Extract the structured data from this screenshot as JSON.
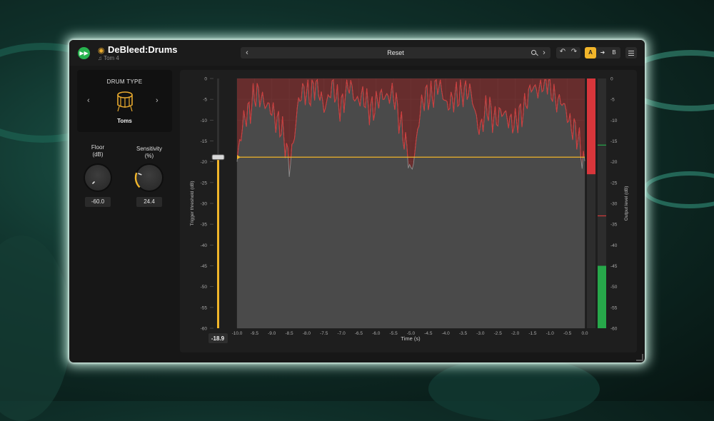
{
  "app": {
    "title": "DeBleed:Drums",
    "subtitle": "Tom 4"
  },
  "preset": {
    "name": "Reset"
  },
  "ab": {
    "a_label": "A",
    "b_label": "B"
  },
  "drum_type": {
    "title": "DRUM TYPE",
    "name": "Toms"
  },
  "floor": {
    "label_line1": "Floor",
    "label_line2": "(dB)",
    "value": "-60.0"
  },
  "sensitivity": {
    "label_line1": "Sensitivity",
    "label_line2": "(%)",
    "value": "24.4",
    "level_percent": 24.4
  },
  "threshold": {
    "value": "-18.9",
    "axis_label": "Trigger threshold (dB)"
  },
  "time_axis": {
    "label": "Time (s)",
    "ticks": [
      "-10.0",
      "-9.5",
      "-9.0",
      "-8.5",
      "-8.0",
      "-7.5",
      "-7.0",
      "-6.5",
      "-6.0",
      "-5.5",
      "-5.0",
      "-4.5",
      "-4.0",
      "-3.5",
      "-3.0",
      "-2.5",
      "-2.0",
      "-1.5",
      "-1.0",
      "-0.5",
      "0.0"
    ]
  },
  "db_axis": {
    "ticks": [
      "0",
      "-5",
      "-10",
      "-15",
      "-20",
      "-25",
      "-30",
      "-35",
      "-40",
      "-45",
      "-50",
      "-55",
      "-60"
    ]
  },
  "output_axis": {
    "label": "Output level (dB)",
    "ticks": [
      "0",
      "-5",
      "-10",
      "-15",
      "-20",
      "-25",
      "-30",
      "-35",
      "-40",
      "-45",
      "-50",
      "-55",
      "-60"
    ]
  },
  "colors": {
    "accent": "#f1b52a",
    "gate_red": "#d23b3b",
    "signal_gray": "#8e8e8e",
    "meter_green": "#27a84a",
    "logo_green": "#27b34e"
  },
  "chart_data": {
    "type": "area",
    "x_range": [
      -10.0,
      0.0
    ],
    "y_range": [
      -60,
      0
    ],
    "threshold_db": -18.9,
    "input_meter_top_db": -23,
    "output_meter_top_db": -45,
    "output_peak_marks_db": [
      -16,
      -33
    ],
    "signal_envelope": {
      "x": [
        -10.0,
        -9.75,
        -9.5,
        -9.25,
        -9.0,
        -8.75,
        -8.5,
        -8.25,
        -8.0,
        -7.75,
        -7.5,
        -7.25,
        -7.0,
        -6.75,
        -6.5,
        -6.25,
        -6.0,
        -5.75,
        -5.5,
        -5.25,
        -5.0,
        -4.75,
        -4.5,
        -4.25,
        -4.0,
        -3.75,
        -3.5,
        -3.25,
        -3.0,
        -2.75,
        -2.5,
        -2.25,
        -2.0,
        -1.75,
        -1.5,
        -1.25,
        -1.0,
        -0.75,
        -0.5,
        -0.25,
        0.0
      ],
      "y": [
        -20,
        -8,
        -5,
        -4,
        -9,
        -10,
        -22,
        -6,
        -3,
        -2,
        -6,
        -3,
        -6,
        -2,
        -5,
        -6,
        -7,
        -3,
        -5,
        -11,
        -24,
        -8,
        -4,
        -2,
        -5,
        -6,
        -2,
        -5,
        -12,
        -7,
        -10,
        -8,
        -12,
        -6,
        -3,
        -1,
        -1,
        -6,
        -8,
        -14,
        -20
      ]
    }
  }
}
